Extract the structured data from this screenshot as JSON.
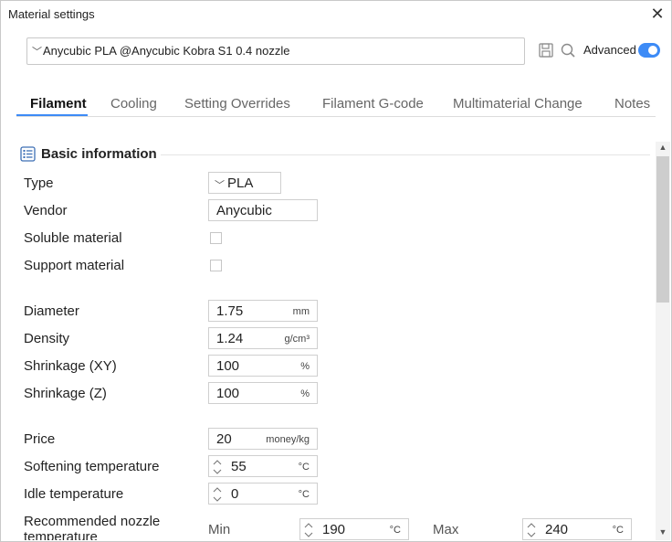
{
  "window": {
    "title": "Material settings"
  },
  "preset": {
    "value": "Anycubic PLA @Anycubic Kobra S1 0.4 nozzle"
  },
  "header": {
    "advanced_label": "Advanced",
    "advanced_on": true,
    "accent": "#3d8bf6"
  },
  "tabs": [
    {
      "label": "Filament",
      "active": true
    },
    {
      "label": "Cooling"
    },
    {
      "label": "Setting Overrides"
    },
    {
      "label": "Filament G-code"
    },
    {
      "label": "Multimaterial Change"
    },
    {
      "label": "Notes"
    }
  ],
  "section": {
    "title": "Basic information",
    "icon": "list-icon"
  },
  "fields": {
    "type": {
      "label": "Type",
      "value": "PLA"
    },
    "vendor": {
      "label": "Vendor",
      "value": "Anycubic"
    },
    "soluble": {
      "label": "Soluble material",
      "checked": false
    },
    "support": {
      "label": "Support material",
      "checked": false
    },
    "diameter": {
      "label": "Diameter",
      "value": "1.75",
      "unit": "mm"
    },
    "density": {
      "label": "Density",
      "value": "1.24",
      "unit": "g/cm³"
    },
    "shrink_xy": {
      "label": "Shrinkage (XY)",
      "value": "100",
      "unit": "%"
    },
    "shrink_z": {
      "label": "Shrinkage (Z)",
      "value": "100",
      "unit": "%"
    },
    "price": {
      "label": "Price",
      "value": "20",
      "unit": "money/kg"
    },
    "softening": {
      "label": "Softening temperature",
      "value": "55",
      "unit": "°C"
    },
    "idle": {
      "label": "Idle temperature",
      "value": "0",
      "unit": "°C"
    },
    "nozzle_temp": {
      "label": "Recommended nozzle temperature",
      "min_label": "Min",
      "min_value": "190",
      "min_unit": "°C",
      "max_label": "Max",
      "max_value": "240",
      "max_unit": "°C"
    }
  }
}
